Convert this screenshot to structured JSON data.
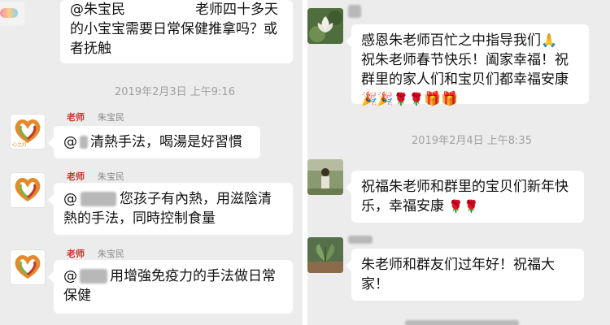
{
  "left_chat": {
    "msg0": {
      "mention": "@朱宝民",
      "gap_after_mention": "            ",
      "text": "老师四十多天的小宝宝需要日常保健推拿吗？或者抚触"
    },
    "time1": "2019年2月3日 上午9:16",
    "msg1": {
      "role": "老师",
      "sender": "朱宝民",
      "mention": "@",
      "text": "清熱手法，喝湯是好習慣"
    },
    "msg2": {
      "role": "老师",
      "sender": "朱宝民",
      "mention": "@",
      "text": "您孩子有內熱，用滋陰清熱的手法，同時控制食量"
    },
    "msg3": {
      "role": "老师",
      "sender": "朱宝民",
      "mention": "@",
      "text": "用增強免疫力的手法做日常保健"
    },
    "avatar_logo": "心之灯"
  },
  "right_chat": {
    "msg1": {
      "text_line1": "感恩朱老师百忙之中指导我们",
      "text_rest": "祝朱老师春节快乐！阖家幸福！祝群里的家人们和宝贝们都幸福安康"
    },
    "time2": "2019年2月4日 上午8:35",
    "msg2": {
      "text": "祝福朱老师和群里的宝贝们新年快乐，幸福安康"
    },
    "msg3": {
      "text": "朱老师和群友们过年好！祝福大家！"
    }
  },
  "emoji_names": {
    "pray": "pray-icon",
    "party": "party-popper-icon",
    "rose": "rose-icon",
    "gift": "gift-icon"
  },
  "colors": {
    "background": "#ececec",
    "bubble": "#ffffff",
    "role": "#c0392b",
    "timestamp": "#a0a0a0"
  }
}
